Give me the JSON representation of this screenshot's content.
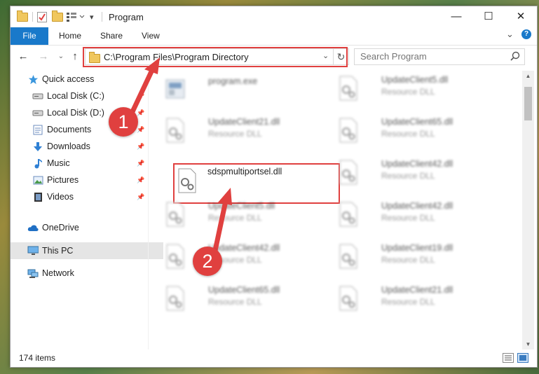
{
  "window": {
    "title": "Program",
    "controls": {
      "minimize": "—",
      "maximize": "☐",
      "close": "✕"
    }
  },
  "ribbon": {
    "tabs": [
      "File",
      "Home",
      "Share",
      "View"
    ],
    "expand_glyph": "⌄",
    "help_glyph": "?"
  },
  "navbar": {
    "back": "←",
    "forward": "→",
    "recent": "⌄",
    "up": "↑",
    "address": "C:\\Program Files\\Program Directory",
    "dropdown": "⌄",
    "refresh": "↻",
    "search_placeholder": "Search Program"
  },
  "sidebar": {
    "items": [
      {
        "label": "Quick access",
        "icon": "star-icon",
        "pinned": false
      },
      {
        "label": "Local Disk (C:)",
        "icon": "drive-icon",
        "pinned": true
      },
      {
        "label": "Local Disk (D:)",
        "icon": "drive-icon",
        "pinned": true
      },
      {
        "label": "Documents",
        "icon": "documents-icon",
        "pinned": true
      },
      {
        "label": "Downloads",
        "icon": "download-icon",
        "pinned": true
      },
      {
        "label": "Music",
        "icon": "music-icon",
        "pinned": true
      },
      {
        "label": "Pictures",
        "icon": "pictures-icon",
        "pinned": true
      },
      {
        "label": "Videos",
        "icon": "videos-icon",
        "pinned": true
      },
      {
        "label": "OneDrive",
        "icon": "cloud-icon",
        "pinned": false
      },
      {
        "label": "This PC",
        "icon": "computer-icon",
        "pinned": false,
        "selected": true
      },
      {
        "label": "Network",
        "icon": "network-icon",
        "pinned": false
      }
    ]
  },
  "files": [
    {
      "name": "program.exe",
      "type": ""
    },
    {
      "name": "UpdateClient5.dll",
      "type": "Resource DLL"
    },
    {
      "name": "UpdateClient21.dll",
      "type": "Resource DLL"
    },
    {
      "name": "UpdateClient65.dll",
      "type": "Resource DLL"
    },
    {
      "name": "sdspmultiportsel.dll",
      "type": "",
      "highlighted": true
    },
    {
      "name": "UpdateClient42.dll",
      "type": "Resource DLL"
    },
    {
      "name": "UpdateClient5.dll",
      "type": "Resource DLL"
    },
    {
      "name": "UpdateClient42.dll",
      "type": "Resource DLL"
    },
    {
      "name": "UpdateClient42.dll",
      "type": "Resource DLL"
    },
    {
      "name": "UpdateClient19.dll",
      "type": "Resource DLL"
    },
    {
      "name": "UpdateClient65.dll",
      "type": "Resource DLL"
    },
    {
      "name": "UpdateClient21.dll",
      "type": "Resource DLL"
    }
  ],
  "status": {
    "item_count": "174 items"
  },
  "annotations": [
    {
      "label": "1",
      "target": "address-bar"
    },
    {
      "label": "2",
      "target": "sdspmultiportsel.dll"
    }
  ],
  "colors": {
    "accent": "#1979ca",
    "annotation": "#e0403f"
  }
}
